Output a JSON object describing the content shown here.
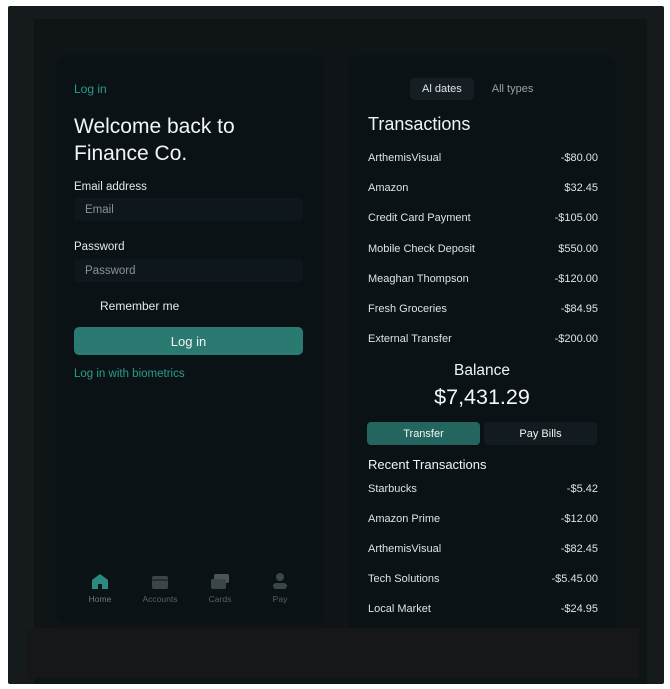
{
  "login": {
    "top_link": "Log in",
    "welcome_title": "Welcome back to Finance Co.",
    "email_label": "Email address",
    "email_placeholder": "Email",
    "email_value": "",
    "password_label": "Password",
    "password_placeholder": "Password",
    "password_value": "",
    "remember_label": "Remember me",
    "remember_checked": false,
    "login_button": "Log in",
    "biometrics_link": "Log in with biometrics"
  },
  "tabbar": {
    "items": [
      {
        "label": "Home",
        "icon": "home-icon",
        "active": true
      },
      {
        "label": "Accounts",
        "icon": "accounts-icon",
        "active": false
      },
      {
        "label": "Cards",
        "icon": "cards-icon",
        "active": false
      },
      {
        "label": "Pay",
        "icon": "pay-icon",
        "active": false
      }
    ]
  },
  "transactions": {
    "filters": [
      {
        "label": "Al dates",
        "selected": true
      },
      {
        "label": "All types",
        "selected": false
      }
    ],
    "title": "Transactions",
    "items": [
      {
        "name": "ArthemisVisual",
        "amount": "-$80.00"
      },
      {
        "name": "Amazon",
        "amount": "$32.45"
      },
      {
        "name": "Credit Card Payment",
        "amount": "-$105.00"
      },
      {
        "name": "Mobile Check Deposit",
        "amount": "$550.00"
      },
      {
        "name": "Meaghan Thompson",
        "amount": "-$120.00"
      },
      {
        "name": "Fresh Groceries",
        "amount": "-$84.95"
      },
      {
        "name": "External Transfer",
        "amount": "-$200.00"
      }
    ],
    "balance_label": "Balance",
    "balance_amount": "$7,431.29",
    "transfer_button": "Transfer",
    "pay_bills_button": "Pay Bills",
    "recent_title": "Recent Transactions",
    "recent_items": [
      {
        "name": "Starbucks",
        "amount": "-$5.42"
      },
      {
        "name": "Amazon Prime",
        "amount": "-$12.00"
      },
      {
        "name": "ArthemisVisual",
        "amount": "-$82.45"
      },
      {
        "name": "Tech Solutions",
        "amount": "-$5.45.00"
      },
      {
        "name": "Local Market",
        "amount": "-$24.95"
      }
    ]
  },
  "colors": {
    "accent": "#2a7a71",
    "link": "#2c9c8c",
    "panel": "#0a1216",
    "background": "#0f1417"
  }
}
